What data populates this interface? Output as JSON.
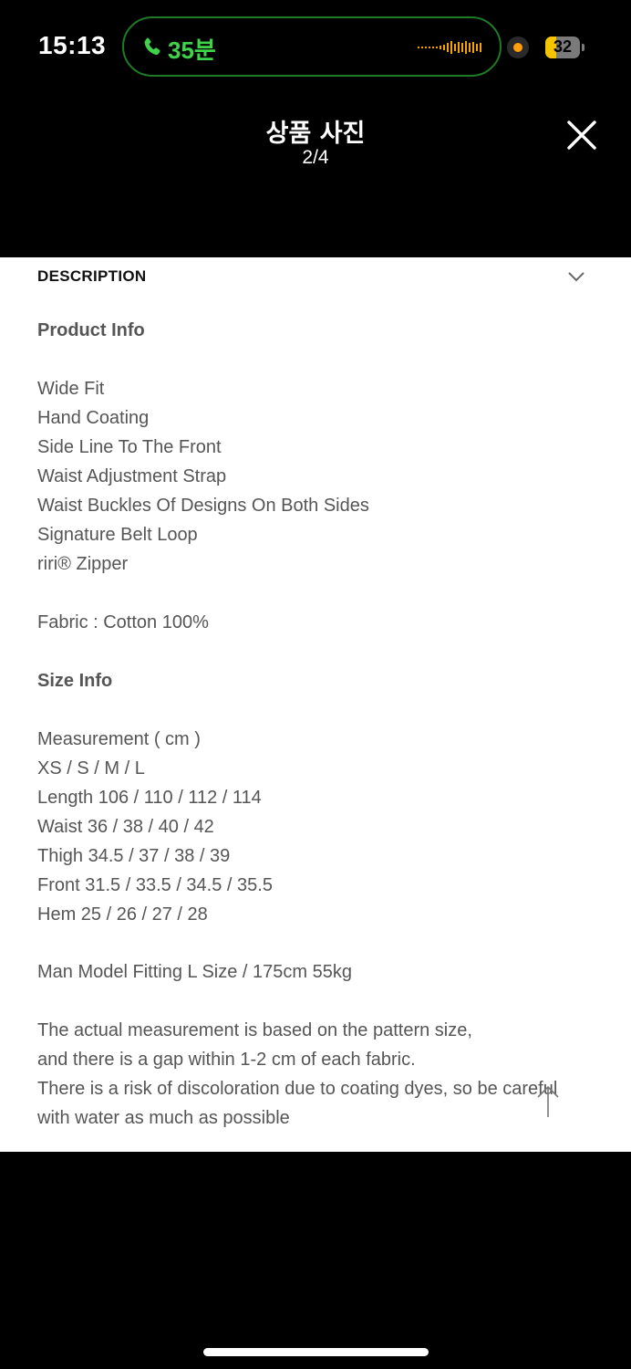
{
  "status_bar": {
    "time": "15:13",
    "call_duration": "35분",
    "battery_level": "32",
    "battery_fraction": 0.32,
    "call_color": "#3fd34a",
    "record_indicator_color": "#ff9d0a",
    "battery_color": "#f5c400"
  },
  "viewer": {
    "title": "상품 사진",
    "counter": "2/4",
    "close_icon": "close-icon"
  },
  "description": {
    "header": "DESCRIPTION",
    "toggle_icon": "chevron-down-icon",
    "product_info_title": "Product Info",
    "features": [
      "Wide Fit",
      "Hand Coating",
      "Side Line To The Front",
      "Waist Adjustment Strap",
      "Waist Buckles Of Designs On Both Sides",
      "Signature Belt Loop",
      "riri® Zipper"
    ],
    "fabric": "Fabric : Cotton 100%",
    "size_info_title": "Size Info",
    "size_lines": [
      "Measurement ( cm )",
      "XS / S / M / L",
      "Length 106 / 110 / 112 / 114",
      "Waist 36 / 38 / 40 / 42",
      "Thigh 34.5 / 37 / 38 / 39",
      "Front 31.5 / 33.5 / 34.5 / 35.5",
      "Hem 25 / 26 / 27 / 28"
    ],
    "model_fitting": "Man Model Fitting L Size / 175cm 55kg",
    "notes": [
      "The actual measurement is based on the pattern size,",
      "and there is a gap within 1-2 cm of each fabric.",
      "There is a risk of discoloration due to coating dyes, so be careful",
      "with water as much as possible"
    ],
    "scroll_top_icon": "arrow-up-icon"
  }
}
